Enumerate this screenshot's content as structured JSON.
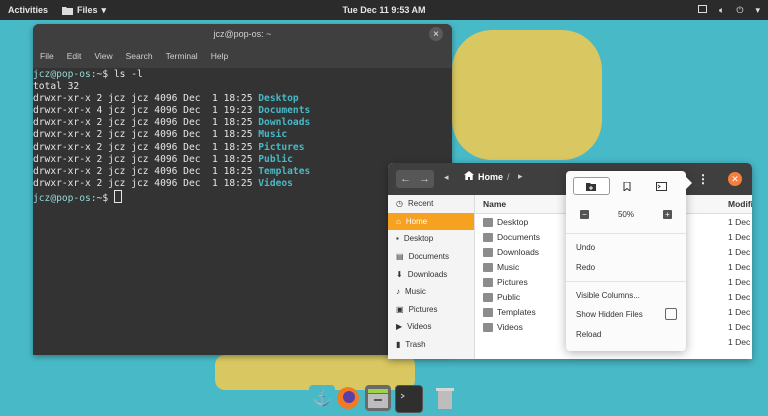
{
  "topbar": {
    "activities": "Activities",
    "app_menu": "Files",
    "clock": "Tue Dec 11   9:53 AM"
  },
  "terminal": {
    "title": "jcz@pop-os: ~",
    "menu": [
      "File",
      "Edit",
      "View",
      "Search",
      "Terminal",
      "Help"
    ],
    "prompt": "jcz@pop-os:",
    "prompt_path": "~$",
    "command": " ls -l",
    "total": "total 32",
    "entries": [
      {
        "perm": "drwxr-xr-x 2 jcz jcz 4096 Dec  1 18:25 ",
        "name": "Desktop"
      },
      {
        "perm": "drwxr-xr-x 4 jcz jcz 4096 Dec  1 19:23 ",
        "name": "Documents"
      },
      {
        "perm": "drwxr-xr-x 2 jcz jcz 4096 Dec  1 18:25 ",
        "name": "Downloads"
      },
      {
        "perm": "drwxr-xr-x 2 jcz jcz 4096 Dec  1 18:25 ",
        "name": "Music"
      },
      {
        "perm": "drwxr-xr-x 2 jcz jcz 4096 Dec  1 18:25 ",
        "name": "Pictures"
      },
      {
        "perm": "drwxr-xr-x 2 jcz jcz 4096 Dec  1 18:25 ",
        "name": "Public"
      },
      {
        "perm": "drwxr-xr-x 2 jcz jcz 4096 Dec  1 18:25 ",
        "name": "Templates"
      },
      {
        "perm": "drwxr-xr-x 2 jcz jcz 4096 Dec  1 18:25 ",
        "name": "Videos"
      }
    ]
  },
  "files": {
    "breadcrumb": "Home",
    "sidebar": [
      "Recent",
      "Home",
      "Desktop",
      "Documents",
      "Downloads",
      "Music",
      "Pictures",
      "Videos",
      "Trash"
    ],
    "columns": {
      "name": "Name",
      "modified": "Modified"
    },
    "rows": [
      {
        "name": "Desktop",
        "modified": "1 Dec"
      },
      {
        "name": "Documents",
        "modified": "1 Dec"
      },
      {
        "name": "Downloads",
        "modified": "1 Dec"
      },
      {
        "name": "Music",
        "modified": "1 Dec"
      },
      {
        "name": "Pictures",
        "modified": "1 Dec"
      },
      {
        "name": "Public",
        "modified": "1 Dec"
      },
      {
        "name": "Templates",
        "modified": "1 Dec"
      },
      {
        "name": "Videos",
        "modified": "1 Dec"
      }
    ],
    "popover": {
      "zoom": "50%",
      "undo": "Undo",
      "redo": "Redo",
      "visible_columns": "Visible Columns...",
      "show_hidden": "Show Hidden Files",
      "reload": "Reload"
    }
  },
  "colors": {
    "accent": "#f6a220",
    "wallpaper": "#48b9c7",
    "close": "#f67e3c"
  }
}
